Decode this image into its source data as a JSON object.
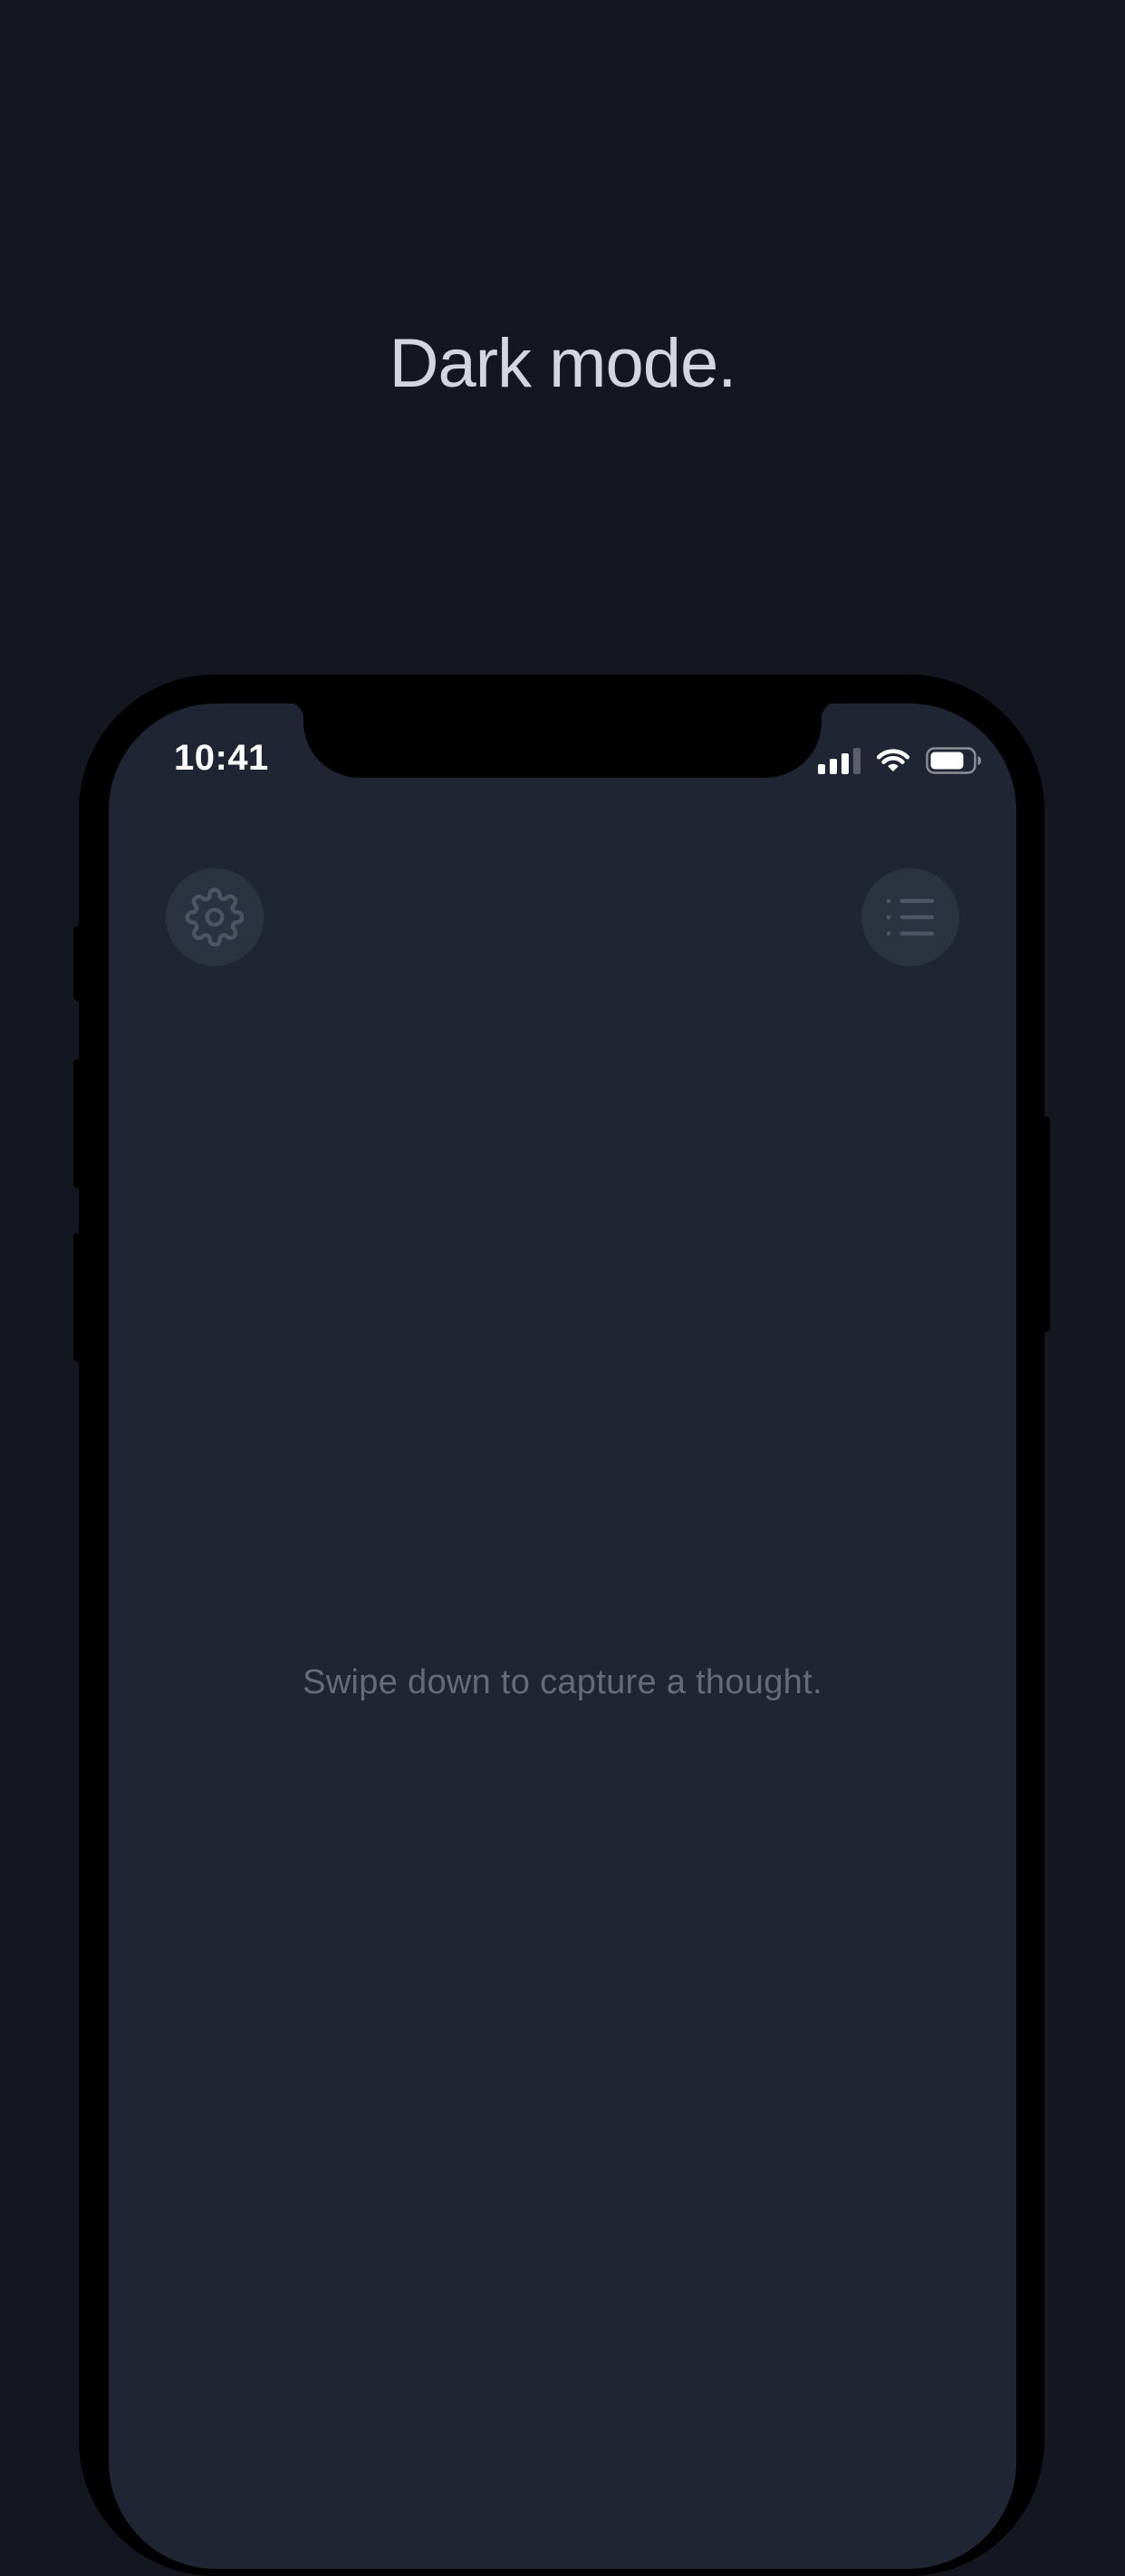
{
  "page": {
    "headline": "Dark mode."
  },
  "status_bar": {
    "time": "10:41",
    "icons": [
      "signal-icon",
      "wifi-icon",
      "battery-icon"
    ]
  },
  "toolbar": {
    "settings_icon": "gear-icon",
    "list_icon": "list-icon"
  },
  "main": {
    "empty_hint": "Swipe down to capture a thought."
  },
  "colors": {
    "background": "#14171f",
    "screen": "#1f2532",
    "button_bg": "#2b3341",
    "icon": "#4c5564",
    "hint_text": "#656c79",
    "headline_text": "#d2d6de"
  }
}
